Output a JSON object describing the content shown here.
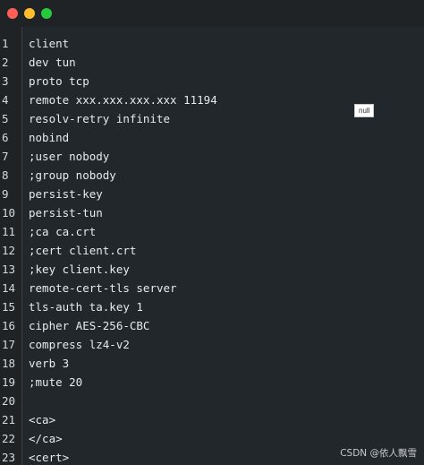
{
  "lines": [
    {
      "number": "1",
      "text": "client"
    },
    {
      "number": "2",
      "text": "dev tun"
    },
    {
      "number": "3",
      "text": "proto tcp"
    },
    {
      "number": "4",
      "text": "remote xxx.xxx.xxx.xxx 11194"
    },
    {
      "number": "5",
      "text": "resolv-retry infinite"
    },
    {
      "number": "6",
      "text": "nobind"
    },
    {
      "number": "7",
      "text": ";user nobody"
    },
    {
      "number": "8",
      "text": ";group nobody"
    },
    {
      "number": "9",
      "text": "persist-key"
    },
    {
      "number": "10",
      "text": "persist-tun"
    },
    {
      "number": "11",
      "text": ";ca ca.crt"
    },
    {
      "number": "12",
      "text": ";cert client.crt"
    },
    {
      "number": "13",
      "text": ";key client.key"
    },
    {
      "number": "14",
      "text": "remote-cert-tls server"
    },
    {
      "number": "15",
      "text": "tls-auth ta.key 1"
    },
    {
      "number": "16",
      "text": "cipher AES-256-CBC"
    },
    {
      "number": "17",
      "text": "compress lz4-v2"
    },
    {
      "number": "18",
      "text": "verb 3"
    },
    {
      "number": "19",
      "text": ";mute 20"
    },
    {
      "number": "20",
      "text": ""
    },
    {
      "number": "21",
      "text": "<ca>"
    },
    {
      "number": "22",
      "text": "</ca>"
    },
    {
      "number": "23",
      "text": "<cert>"
    }
  ],
  "tooltip": "null",
  "watermark": "CSDN @依人飘雪",
  "colors": {
    "background": "#22272b",
    "gutter": "#1f2326",
    "text": "#e7eaee",
    "close": "#ff5f56",
    "minimize": "#ffbd2e",
    "maximize": "#27c93f"
  }
}
